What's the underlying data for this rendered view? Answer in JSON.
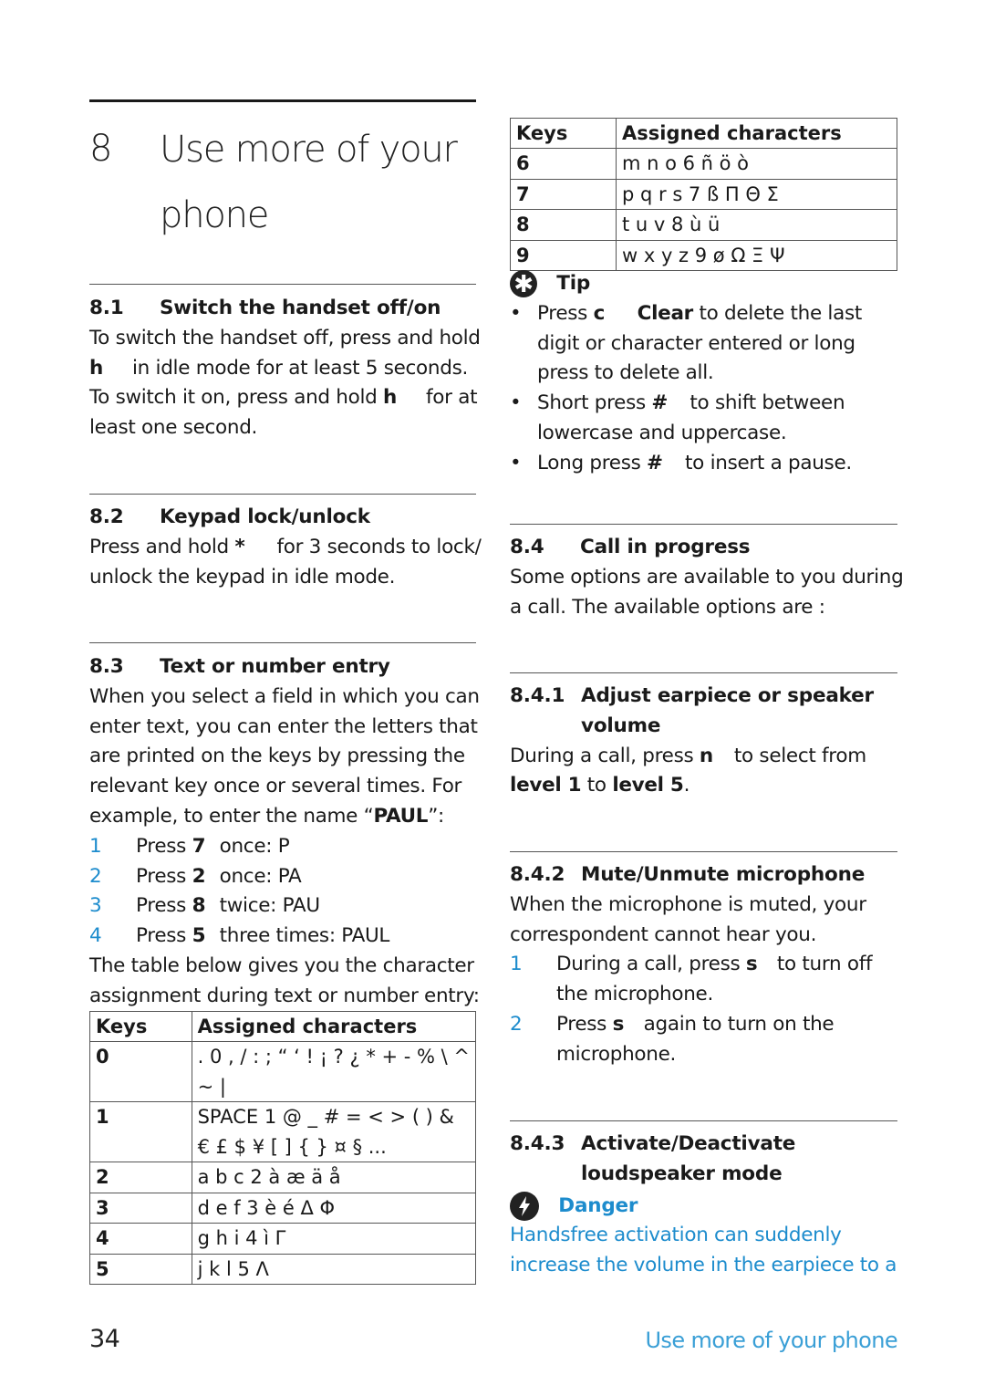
{
  "chapter": {
    "number": "8",
    "title_line1": "Use more of your",
    "title_line2": "phone"
  },
  "s81": {
    "number": "8.1",
    "title": "Switch the handset off/on",
    "lines": [
      [
        "To switch the handset off, press and hold"
      ],
      [
        "h",
        "in idle mode for at least 5 seconds."
      ],
      [
        "To switch it on, press and hold ",
        "h",
        "for at"
      ],
      [
        "least one second."
      ]
    ]
  },
  "s82": {
    "number": "8.2",
    "title": "Keypad lock/unlock",
    "line1_pre": "Press and hold ",
    "line1_key": "*",
    "line1_post": "for 3 seconds to lock/",
    "line2": "unlock the keypad in idle mode."
  },
  "s83": {
    "number": "8.3",
    "title": "Text or number entry",
    "lines": [
      "When you select a field in which you can",
      "enter text, you can enter the letters that",
      "are printed on the keys by pressing the",
      "relevant key once or several times. For"
    ],
    "example_pre": "example, to enter the name “",
    "example_name": "PAUL",
    "example_post": "”:",
    "steps": [
      {
        "n": "1",
        "pre": "Press ",
        "key": "7",
        "post": "once: P"
      },
      {
        "n": "2",
        "pre": "Press ",
        "key": "2",
        "post": "once: PA"
      },
      {
        "n": "3",
        "pre": "Press ",
        "key": "8",
        "post": "twice: PAU"
      },
      {
        "n": "4",
        "pre": "Press ",
        "key": "5",
        "post": "three times: PAUL"
      }
    ],
    "after_1": "The table below gives you the character",
    "after_2": "assignment during text or number entry:"
  },
  "table": {
    "col_keys": "Keys",
    "col_chars": "Assigned characters",
    "rows_left": [
      {
        "key": "0",
        "chars": ". 0 , / : ;  “ ‘ ! ¡ ? ¿ * + - % \\ ^",
        "chars2": "~ |"
      },
      {
        "key": "1",
        "chars": "SPACE 1 @ _ # = < > ( ) &",
        "chars2": "€ £ $ ¥ [ ] { } ¤ § ..."
      },
      {
        "key": "2",
        "chars": "a b c 2 à æ ä å"
      },
      {
        "key": "3",
        "chars": "d e f 3 è é Δ Φ"
      },
      {
        "key": "4",
        "chars": "g h i 4 ì Γ"
      },
      {
        "key": "5",
        "chars": "j k l 5 Λ"
      }
    ],
    "rows_right": [
      {
        "key": "6",
        "chars": "m n o 6 ñ ö ò"
      },
      {
        "key": "7",
        "chars": "p q r s 7 ß Π Θ Σ"
      },
      {
        "key": "8",
        "chars": "t u v 8 ù ü"
      },
      {
        "key": "9",
        "chars": "w x y z 9 ø Ω Ξ Ψ"
      }
    ]
  },
  "tip": {
    "icon": "asterisk-icon",
    "title": "Tip",
    "bullets": [
      {
        "lines": [
          [
            "Press ",
            "c",
            "Clear",
            " to delete the last"
          ],
          [
            "digit or character entered or long"
          ],
          [
            "press to delete all."
          ]
        ]
      },
      {
        "lines": [
          [
            "Short press ",
            "#",
            "to shift between"
          ],
          [
            "lowercase and uppercase."
          ]
        ]
      },
      {
        "lines": [
          [
            "Long press ",
            "#",
            "to insert a pause."
          ]
        ]
      }
    ]
  },
  "s84": {
    "number": "8.4",
    "title": "Call in progress",
    "line1": "Some options are available to you during",
    "line2": "a call. The available options are :"
  },
  "s841": {
    "number": "8.4.1",
    "title1": "Adjust earpiece or speaker",
    "title2": "volume",
    "line1_pre": "During a call, press ",
    "line1_key": "n",
    "line1_post": "to select from",
    "level_a": "level 1",
    "level_mid": " to ",
    "level_b": "level 5",
    "level_end": "."
  },
  "s842": {
    "number": "8.4.2",
    "title": "Mute/Unmute microphone",
    "line1": "When the microphone is muted, your",
    "line2": "correspondent cannot hear you.",
    "steps": [
      {
        "n": "1",
        "pre": "During a call, press ",
        "key": "s",
        "post": "to turn off",
        "line2": "the microphone."
      },
      {
        "n": "2",
        "pre": "Press ",
        "key": "s",
        "post": "again to turn on the",
        "line2": "microphone."
      }
    ]
  },
  "s843": {
    "number": "8.4.3",
    "title1": "Activate/Deactivate",
    "title2": "loudspeaker mode"
  },
  "danger": {
    "icon": "lightning-icon",
    "title": "Danger",
    "line1": "Handsfree activation can suddenly",
    "line2": "increase the volume in the earpiece to a",
    "color": "#1d8ccd"
  },
  "footer": {
    "page_number": "34",
    "section_title": "Use more of your phone"
  }
}
